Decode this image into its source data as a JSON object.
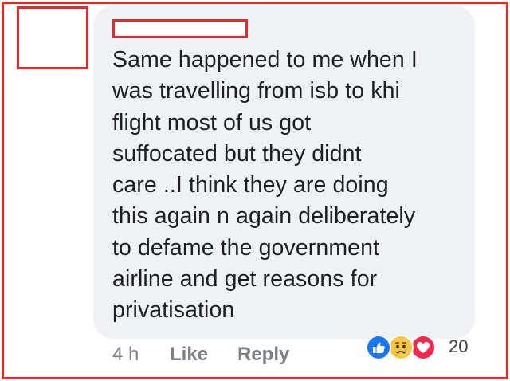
{
  "comment": {
    "text_lines": [
      "Same happened to me when I",
      "was travelling from isb to khi",
      "flight most of us got",
      "suffocated but they didnt",
      "care ..I think they are doing",
      "this again n again deliberately",
      "to defame the government",
      "airline and get reasons for",
      "privatisation"
    ]
  },
  "meta": {
    "timestamp": "4 h",
    "like_label": "Like",
    "reply_label": "Reply"
  },
  "reactions": {
    "icons": [
      "like-reaction-icon",
      "sad-reaction-icon",
      "love-reaction-icon"
    ],
    "count": "20"
  },
  "colors": {
    "bubble": "#f0f1f4",
    "text": "#1c1e21",
    "meta": "#7b8089",
    "redaction_border": "#e02a2b",
    "like_blue": "#1877f2",
    "love_red": "#f0284a",
    "sad_yellow": "#f7c744"
  }
}
